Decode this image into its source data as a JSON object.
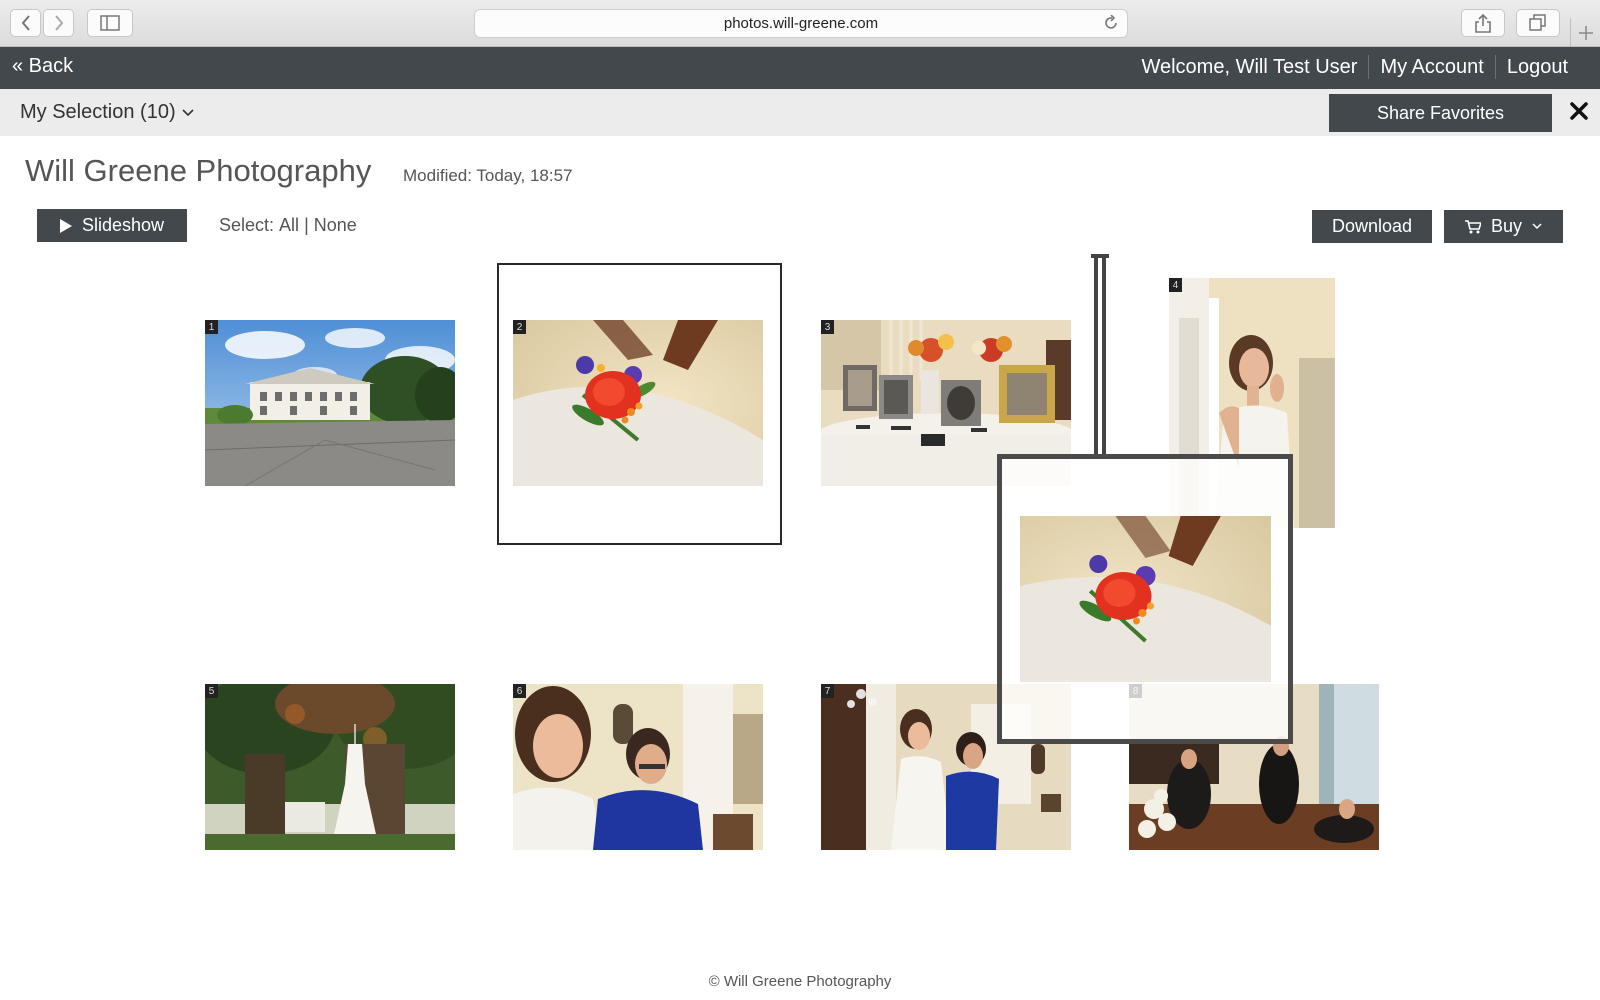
{
  "browser": {
    "url": "photos.will-greene.com",
    "icons": [
      "chevron-left-icon",
      "chevron-right-icon",
      "sidebar-icon",
      "reload-icon",
      "share-icon",
      "tabs-icon",
      "plus-icon"
    ]
  },
  "topbar": {
    "back_label": "« Back",
    "welcome": "Welcome, Will Test User",
    "my_account": "My Account",
    "logout": "Logout"
  },
  "selection_bar": {
    "label": "My Selection (10)",
    "share_label": "Share Favorites"
  },
  "gallery": {
    "title": "Will Greene Photography",
    "modified": "Modified: Today, 18:57",
    "slideshow_label": "Slideshow",
    "select_prefix": "Select:",
    "select_all": "All",
    "select_sep": "|",
    "select_none": "None",
    "download_label": "Download",
    "buy_label": "Buy",
    "photos": [
      {
        "number": "1",
        "subject": "estate house"
      },
      {
        "number": "2",
        "subject": "boutonniere"
      },
      {
        "number": "3",
        "subject": "memorial table"
      },
      {
        "number": "4",
        "subject": "bride earrings"
      },
      {
        "number": "5",
        "subject": "dress on tree"
      },
      {
        "number": "6",
        "subject": "bride and mother"
      },
      {
        "number": "7",
        "subject": "bride with mother"
      },
      {
        "number": "8",
        "subject": "bridesmaids room"
      }
    ]
  },
  "colors": {
    "dark_bar": "#43484d",
    "light_bar": "#ececec",
    "text": "#555555"
  },
  "footer": {
    "copyright": "© Will Greene Photography"
  }
}
